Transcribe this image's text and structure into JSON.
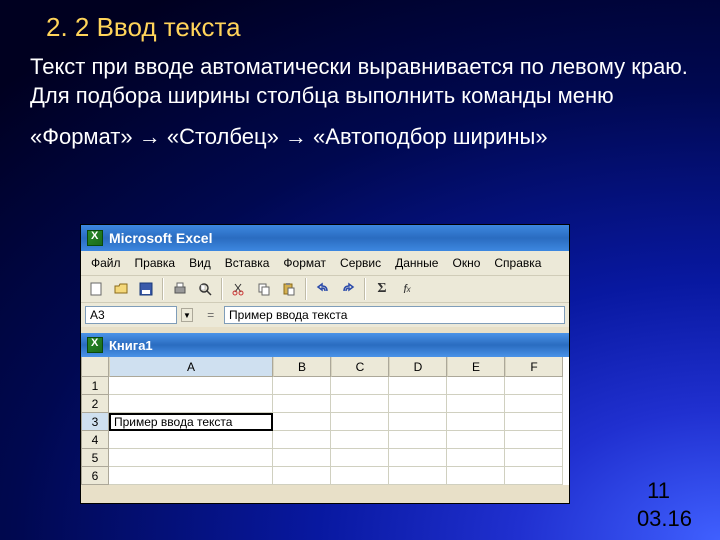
{
  "slide": {
    "title": "2. 2 Ввод текста",
    "paragraph": "Текст при вводе автоматически выравнивается по левому краю. Для подбора ширины столбца выполнить команды меню",
    "path": " «Формат» → «Столбец» → «Автоподбор ширины»",
    "page_number": "11",
    "date": "03.16"
  },
  "excel": {
    "app_title": "Microsoft Excel",
    "menu": {
      "file": "Файл",
      "edit": "Правка",
      "view": "Вид",
      "insert": "Вставка",
      "format": "Формат",
      "tools": "Сервис",
      "data": "Данные",
      "window": "Окно",
      "help": "Справка"
    },
    "name_box": "A3",
    "formula_label": "=",
    "formula_value": "Пример ввода текста",
    "book_title": "Книга1",
    "columns": [
      "A",
      "B",
      "C",
      "D",
      "E",
      "F"
    ],
    "rows": [
      "1",
      "2",
      "3",
      "4",
      "5",
      "6"
    ],
    "cell_A3": "Пример ввода текста"
  }
}
